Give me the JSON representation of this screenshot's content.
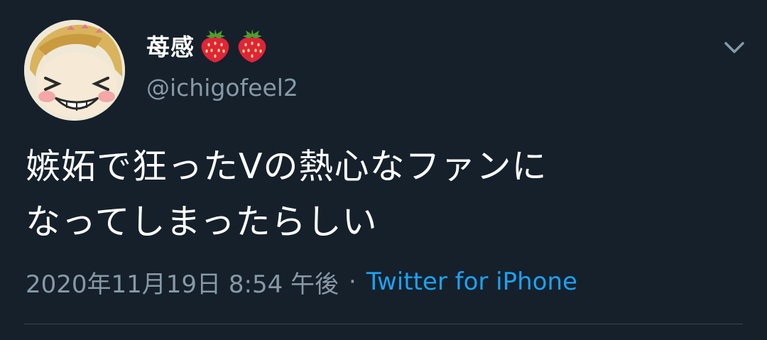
{
  "user": {
    "display_name": "苺感",
    "name_emoji": [
      "strawberry-emoji",
      "strawberry-emoji"
    ],
    "handle": "@ichigofeel2"
  },
  "tweet": {
    "text_lines": [
      "嫉妬で狂ったVの熱心なファンに",
      "なってしまったらしい"
    ],
    "timestamp": "2020年11月19日 8:54 午後",
    "separator": "·",
    "source": "Twitter for iPhone"
  },
  "icons": {
    "menu": "chevron-down-icon"
  },
  "colors": {
    "background": "#15202b",
    "text": "#ffffff",
    "muted": "#8899a6",
    "link": "#1da1f2",
    "divider": "#38444d"
  }
}
